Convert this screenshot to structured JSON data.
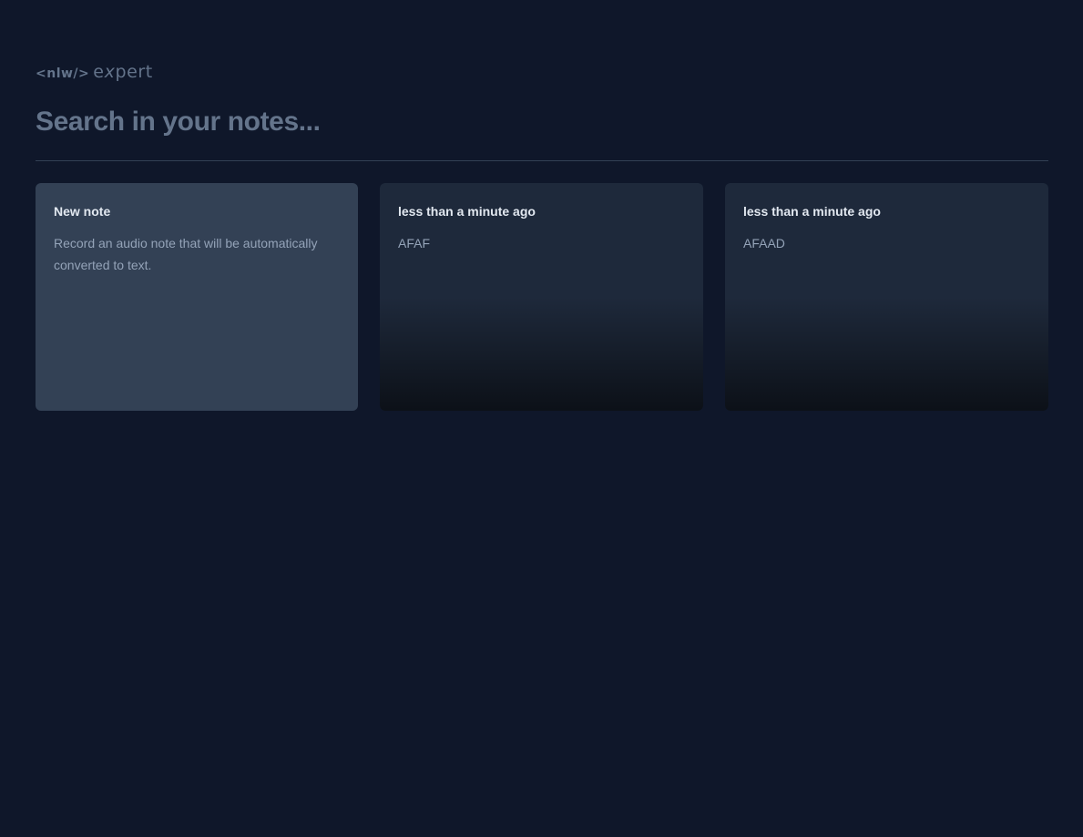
{
  "logo": {
    "code": "<nlw/>",
    "word_start": "e",
    "word_x": "x",
    "word_end": "pert"
  },
  "search": {
    "value": "",
    "placeholder": "Search in your notes..."
  },
  "new_note_card": {
    "title": "New note",
    "description": "Record an audio note that will be automatically converted to text."
  },
  "notes": [
    {
      "date": "less than a minute ago",
      "content": "AFAF"
    },
    {
      "date": "less than a minute ago",
      "content": "AFAAD"
    }
  ],
  "colors": {
    "background": "#0f172a",
    "new_card": "#334155",
    "note_card": "#1e293b",
    "muted_text": "#94a3b8",
    "placeholder": "#64748b"
  }
}
